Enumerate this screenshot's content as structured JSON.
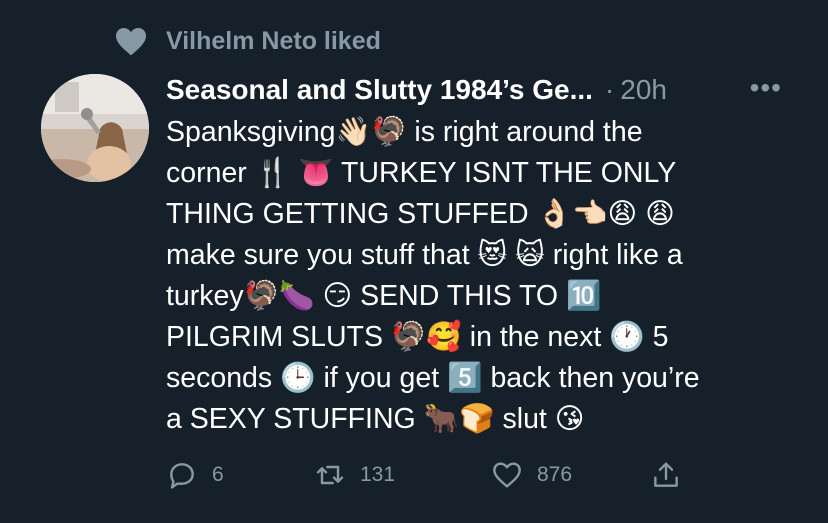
{
  "social_context": {
    "text": "Vilhelm Neto liked",
    "icon": "heart-icon"
  },
  "tweet": {
    "author": "Seasonal and Slutty 1984’s Ge...",
    "separator": "·",
    "time": "20h",
    "more": "•••",
    "avatar": "profile-photo",
    "lines": [
      "Spanksgiving👋🏻🦃 is right around the",
      "corner 🍴 👅 TURKEY ISNT THE ONLY",
      "THING GETTING STUFFED 👌🏻👈🏻😩 😩",
      "make sure you stuff that 😻 🙀 right like a",
      "turkey🦃🍆 😏  SEND THIS TO 🔟",
      "PILGRIM SLUTS 🦃🥰 in the next 🕐 5",
      "seconds 🕒 if you get 5️⃣ back then you’re",
      "a SEXY STUFFING 🐂🍞 slut 😘"
    ]
  },
  "actions": {
    "reply": {
      "icon": "reply-icon",
      "count": "6"
    },
    "retweet": {
      "icon": "retweet-icon",
      "count": "131"
    },
    "like": {
      "icon": "heart-outline-icon",
      "count": "876"
    },
    "share": {
      "icon": "share-icon",
      "count": ""
    }
  },
  "colors": {
    "background": "#15202b",
    "text": "#ffffff",
    "muted": "#8899a6"
  }
}
